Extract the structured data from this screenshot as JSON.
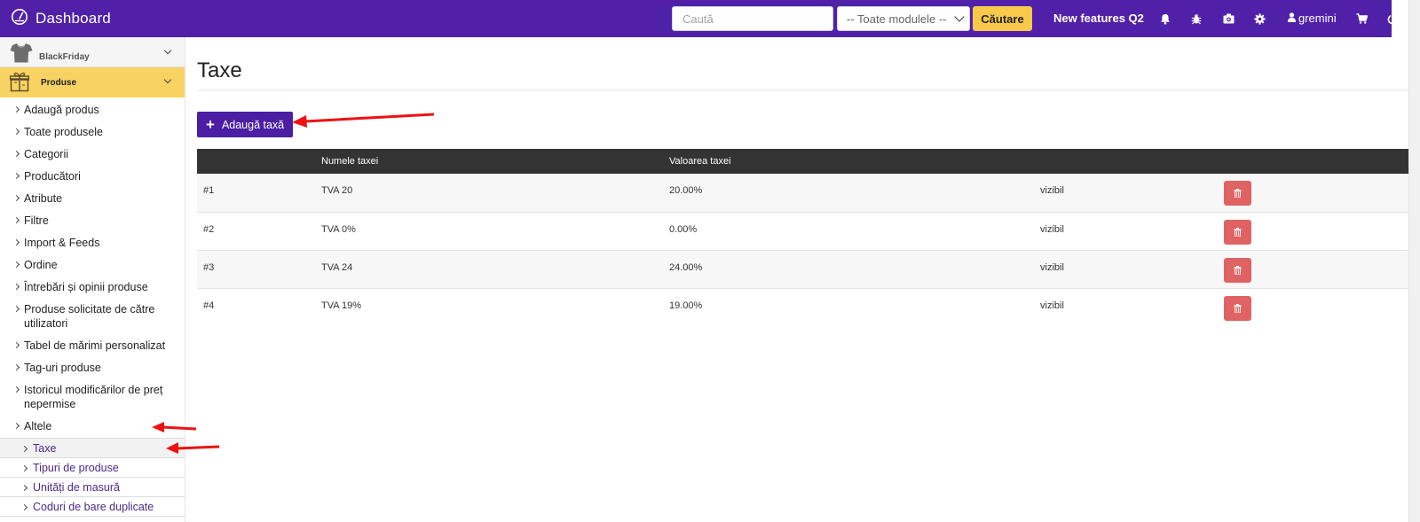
{
  "app": {
    "title": "Dashboard"
  },
  "topbar": {
    "search_placeholder": "Caută",
    "module_select_value": "-- Toate modulele --",
    "search_button": "Căutare",
    "features_link": "New features Q2",
    "username": "gremini",
    "icons": [
      "bell-icon",
      "bug-icon",
      "camera-icon",
      "gear-icon",
      "user-icon",
      "cart-icon",
      "power-icon"
    ]
  },
  "sidebar": {
    "store": {
      "name": "BlackFriday",
      "icon": "tshirt-icon"
    },
    "section": {
      "name": "Produse",
      "icon": "gift-icon"
    },
    "items": [
      {
        "label": "Adaugă produs"
      },
      {
        "label": "Toate produsele"
      },
      {
        "label": "Categorii"
      },
      {
        "label": "Producători"
      },
      {
        "label": "Atribute"
      },
      {
        "label": "Filtre"
      },
      {
        "label": "Import & Feeds"
      },
      {
        "label": "Ordine"
      },
      {
        "label": "Întrebări și opinii produse"
      },
      {
        "label": "Produse solicitate de către utilizatori"
      },
      {
        "label": "Tabel de mărimi personalizat"
      },
      {
        "label": "Tag-uri produse"
      },
      {
        "label": "Istoricul modificărilor de preț nepermise"
      },
      {
        "label": "Altele"
      }
    ],
    "subitems": [
      {
        "label": "Taxe",
        "active": true
      },
      {
        "label": "Tipuri de produse"
      },
      {
        "label": "Unități de masură"
      },
      {
        "label": "Coduri de bare duplicate"
      }
    ]
  },
  "main": {
    "title": "Taxe",
    "add_button": "Adaugă taxă",
    "table": {
      "columns": [
        "",
        "Numele taxei",
        "Valoarea taxei",
        "",
        ""
      ],
      "rows": [
        {
          "id": "#1",
          "name": "TVA 20",
          "value": "20.00%",
          "status": "vizibil"
        },
        {
          "id": "#2",
          "name": "TVA 0%",
          "value": "0.00%",
          "status": "vizibil"
        },
        {
          "id": "#3",
          "name": "TVA 24",
          "value": "24.00%",
          "status": "vizibil"
        },
        {
          "id": "#4",
          "name": "TVA 19%",
          "value": "19.00%",
          "status": "vizibil"
        }
      ]
    }
  },
  "colors": {
    "topbar": "#5021a8",
    "accent_yellow": "#f8c94a",
    "section_yellow": "#f8d263",
    "primary_button": "#4b1ea3",
    "delete_button": "#e06363",
    "table_header": "#333333",
    "annotation_arrow": "#ee1111"
  }
}
